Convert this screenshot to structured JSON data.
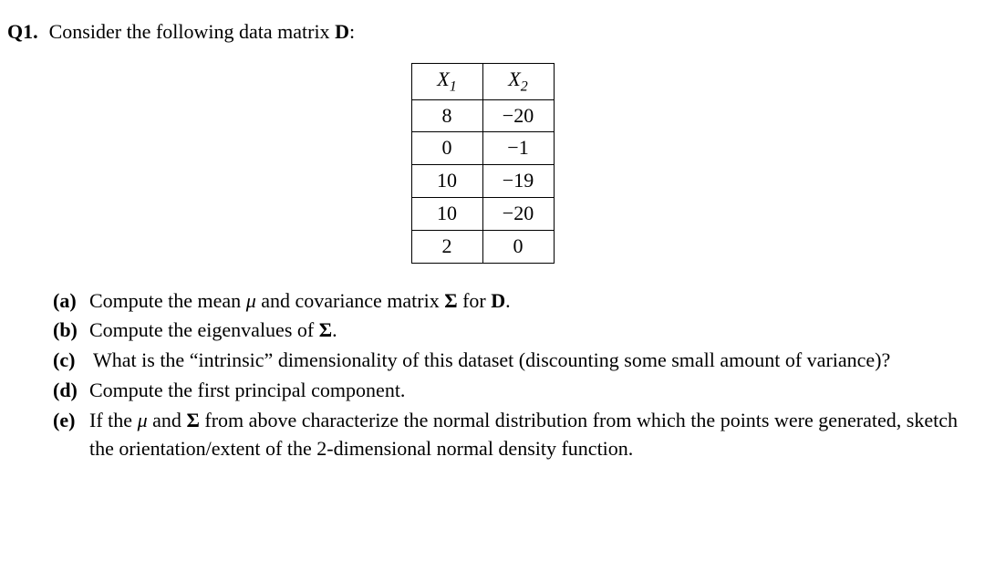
{
  "question": {
    "label": "Q1.",
    "intro_pre": "Consider the following data matrix ",
    "intro_var": "D",
    "intro_post": ":"
  },
  "table": {
    "headers": {
      "h1_base": "X",
      "h1_sub": "1",
      "h2_base": "X",
      "h2_sub": "2"
    },
    "rows": [
      {
        "c1": "8",
        "c2": "−20"
      },
      {
        "c1": "0",
        "c2": "−1"
      },
      {
        "c1": "10",
        "c2": "−19"
      },
      {
        "c1": "10",
        "c2": "−20"
      },
      {
        "c1": "2",
        "c2": "0"
      }
    ]
  },
  "parts": {
    "a": {
      "label": "(a)",
      "t1": "Compute the mean ",
      "mu": "μ",
      "t2": " and covariance matrix ",
      "sigma": "Σ",
      "t3": " for ",
      "dvar": "D",
      "t4": "."
    },
    "b": {
      "label": "(b)",
      "t1": "Compute the eigenvalues of ",
      "sigma": "Σ",
      "t2": "."
    },
    "c": {
      "label": "(c)",
      "t1": "What is the “intrinsic” dimensionality of this dataset (discounting some small amount of variance)?"
    },
    "d": {
      "label": "(d)",
      "t1": "Compute the first principal component."
    },
    "e": {
      "label": "(e)",
      "t1": "If the ",
      "mu": "μ",
      "t2": " and ",
      "sigma": "Σ",
      "t3": " from above characterize the normal distribution from which the points were generated, sketch the orientation/extent of the 2-dimensional normal density function."
    }
  }
}
